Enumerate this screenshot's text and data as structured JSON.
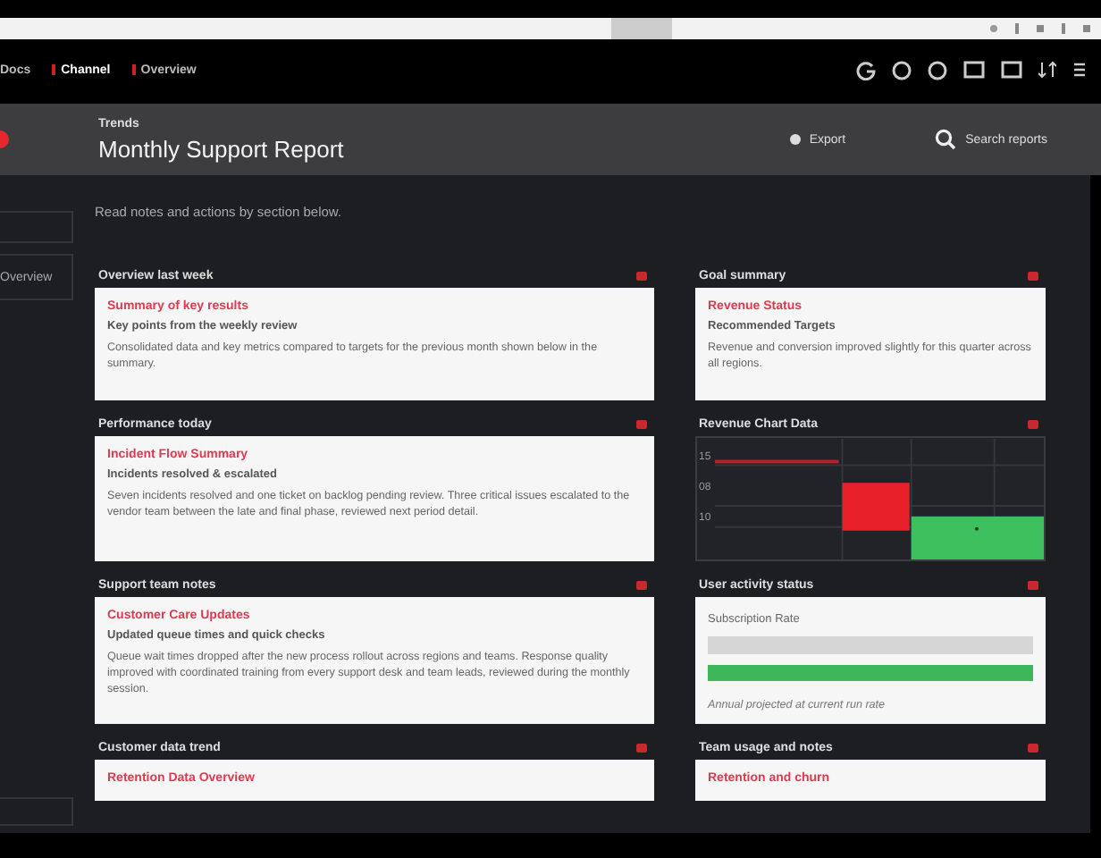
{
  "nav": {
    "items": [
      {
        "label": "Docs",
        "selected": false
      },
      {
        "label": "Channel",
        "selected": true
      },
      {
        "label": "Overview",
        "selected": false
      }
    ]
  },
  "header": {
    "overline": "Trends",
    "title": "Monthly Support Report",
    "export_label": "Export",
    "search_label": "Search reports"
  },
  "intro": "Read notes and actions by section below.",
  "sidebar": {
    "items": [
      {
        "selected": false
      },
      {
        "label": "Overview",
        "selected": false
      }
    ]
  },
  "left": [
    {
      "heading": "Overview last week",
      "kind": "text",
      "title": "Summary of key results",
      "subtitle": "Key points from the weekly review",
      "body": "Consolidated data and key metrics compared to targets for the previous month shown below in the summary."
    },
    {
      "heading": "Performance today",
      "kind": "text",
      "title": "Incident Flow Summary",
      "subtitle": "Incidents resolved & escalated",
      "body": "Seven incidents resolved and one ticket on backlog pending review. Three critical issues escalated to the vendor team between the late and final phase, reviewed next period detail."
    },
    {
      "heading": "Support team notes",
      "kind": "text",
      "title": "Customer Care Updates",
      "subtitle": "Updated queue times and quick checks",
      "body": "Queue wait times dropped after the new process rollout across regions and teams. Response quality improved with coordinated training from every support desk and team leads, reviewed during the monthly session."
    },
    {
      "heading": "Customer data trend",
      "kind": "text",
      "title": "Retention Data Overview"
    }
  ],
  "right": [
    {
      "heading": "Goal summary",
      "kind": "text",
      "title": "Revenue Status",
      "subtitle": "Recommended Targets",
      "body": "Revenue and conversion improved slightly for this quarter across all regions."
    },
    {
      "heading": "Revenue Chart Data",
      "kind": "chart",
      "axis_labels": [
        "15",
        "08",
        "10"
      ]
    },
    {
      "heading": "User activity status",
      "kind": "meters",
      "label": "Subscription Rate",
      "meters": [
        {
          "level": 0
        },
        {
          "level": 1
        }
      ],
      "note": "Annual projected at current run rate"
    },
    {
      "heading": "Team usage and notes",
      "kind": "text",
      "title": "Retention and churn"
    }
  ]
}
